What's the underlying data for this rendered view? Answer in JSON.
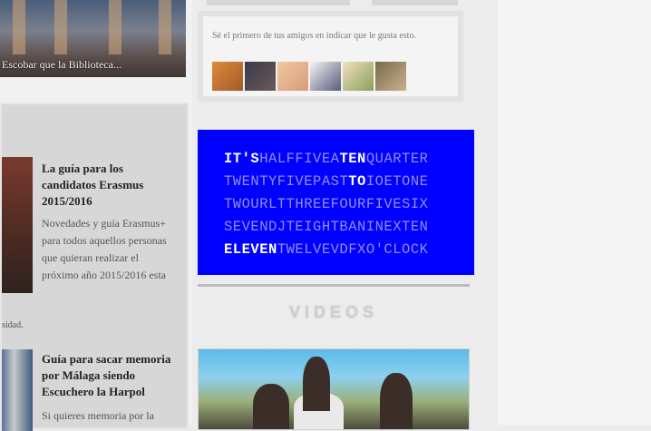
{
  "left": {
    "hero_caption": "Escobar que la Biblioteca...",
    "news": [
      {
        "title": "La guía para los candidatos Erasmus 2015/2016",
        "body": "Novedades y guía Erasmus+ para todos aquellos personas que quieran realizar el próximo año 2015/2016 esta"
      },
      {
        "title": "Guía para sacar memoria por Málaga siendo Escuchero la Harpol",
        "body": "Si quieres memoria por la"
      }
    ],
    "news_small": "sidad."
  },
  "friends": {
    "text": "Sé el primero de tus amigos en indicar que le gusta esto.",
    "avatars": [
      "avatar-1",
      "avatar-2",
      "avatar-3",
      "avatar-4",
      "avatar-5",
      "avatar-6"
    ]
  },
  "clock": {
    "rows": [
      [
        {
          "t": "IT'S",
          "on": true
        },
        {
          "t": "HALFFIVEA",
          "on": false
        },
        {
          "t": "TEN",
          "on": true
        },
        {
          "t": "QUARTER",
          "on": false
        }
      ],
      [
        {
          "t": "TWENTYFIVEPAST",
          "on": false
        },
        {
          "t": "TO",
          "on": true
        },
        {
          "t": "IOETONE",
          "on": false
        }
      ],
      [
        {
          "t": "TWOURLTTHREEFOURFIVESIX",
          "on": false
        }
      ],
      [
        {
          "t": "SEVENDJTEIGHTBANINEXTEN",
          "on": false
        }
      ],
      [
        {
          "t": "ELEVEN",
          "on": true
        },
        {
          "t": "TWELVEVDFXO'CLOCK",
          "on": false
        }
      ]
    ]
  },
  "videos": {
    "heading": "VIDEOS"
  }
}
